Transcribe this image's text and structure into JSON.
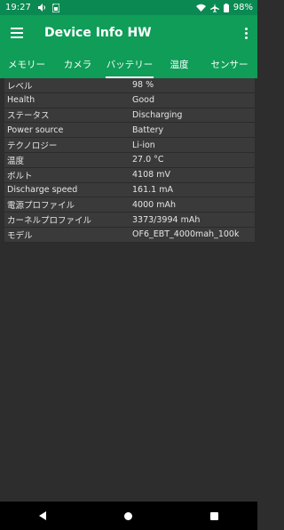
{
  "status": {
    "time": "19:27",
    "battery": "98%"
  },
  "app": {
    "title": "Device Info HW"
  },
  "tabs": [
    {
      "label": "メモリー"
    },
    {
      "label": "カメラ"
    },
    {
      "label": "バッテリー",
      "active": true
    },
    {
      "label": "温度"
    },
    {
      "label": "センサー"
    }
  ],
  "battery": {
    "rows": [
      {
        "key": "レベル",
        "value": "98 %"
      },
      {
        "key": "Health",
        "value": "Good"
      },
      {
        "key": "ステータス",
        "value": "Discharging"
      },
      {
        "key": "Power source",
        "value": "Battery"
      },
      {
        "key": "テクノロジー",
        "value": "Li-ion"
      },
      {
        "key": "温度",
        "value": "27.0 °C"
      },
      {
        "key": "ボルト",
        "value": "4108 mV"
      },
      {
        "key": "Discharge speed",
        "value": "161.1 mA"
      },
      {
        "key": "電源プロファイル",
        "value": "4000 mAh"
      },
      {
        "key": "カーネルプロファイル",
        "value": "3373/3994 mAh"
      },
      {
        "key": "モデル",
        "value": "OF6_EBT_4000mah_100k"
      }
    ]
  }
}
